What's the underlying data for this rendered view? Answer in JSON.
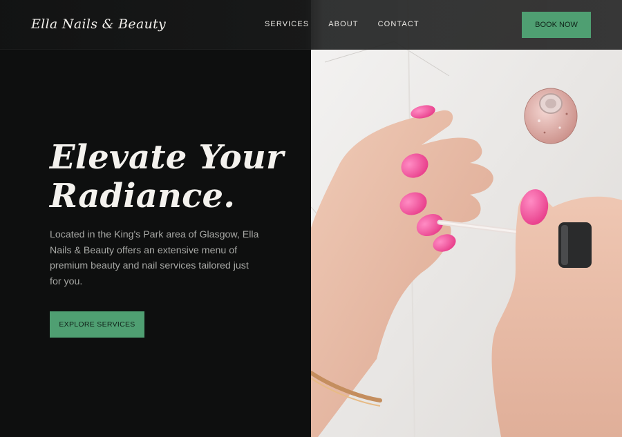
{
  "header": {
    "brand": "Ella Nails & Beauty",
    "nav_links": [
      "SERVICES",
      "ABOUT",
      "CONTACT"
    ],
    "book_button": "BOOK NOW"
  },
  "hero": {
    "title_line1": "Elevate Your",
    "title_line2": "Radiance.",
    "description": "Located in the King's Park area of Glasgow, Ella Nails & Beauty offers an extensive menu of premium beauty and nail services tailored just for you.",
    "cta": "EXPLORE SERVICES"
  },
  "colors": {
    "accent": "#4f9f72",
    "background": "#0e0f0f",
    "nail_polish": "#f0509a"
  }
}
